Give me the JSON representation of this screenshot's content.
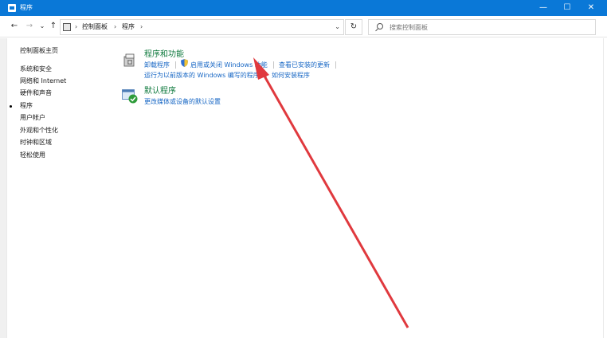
{
  "window": {
    "title": "程序",
    "min": "—",
    "max": "☐",
    "close": "✕"
  },
  "nav": {
    "back": "←",
    "forward": "→",
    "dropdown": "⌄",
    "up": "↑",
    "refresh": "↻",
    "path_dropdown": "⌄"
  },
  "breadcrumb": {
    "sep": "›",
    "items": [
      "控制面板",
      "程序"
    ]
  },
  "search": {
    "placeholder": "搜索控制面板"
  },
  "sidebar": {
    "home": "控制面板主页",
    "items": [
      "系统和安全",
      "网络和 Internet",
      "硬件和声音",
      "程序",
      "用户帐户",
      "外观和个性化",
      "时钟和区域",
      "轻松使用"
    ],
    "active_index": 3
  },
  "categories": [
    {
      "title": "程序和功能",
      "links_row1": [
        "卸载程序",
        "启用或关闭 Windows 功能",
        "查看已安装的更新"
      ],
      "links_row2": [
        "运行为以前版本的 Windows 编写的程序",
        "如何安装程序"
      ]
    },
    {
      "title": "默认程序",
      "links_row1": [
        "更改媒体或设备的默认设置"
      ]
    }
  ],
  "colors": {
    "titlebar": "#0a78d7",
    "category": "#0f7a3e",
    "link": "#1666c4",
    "arrow": "#e0393e"
  },
  "icons": {
    "app": "control-panel-icon",
    "search": "search-icon",
    "shield": "uac-shield-icon",
    "programs": "programs-features-icon",
    "default": "default-programs-icon"
  }
}
